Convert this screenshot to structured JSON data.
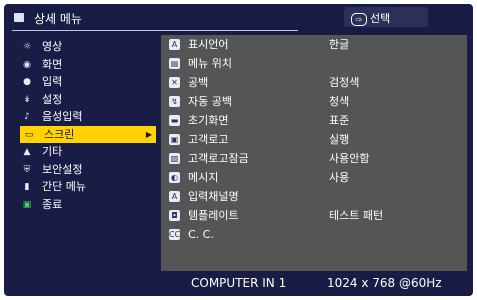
{
  "header": {
    "title": "상세 메뉴",
    "select_label": "선택",
    "select_key": "⇨"
  },
  "left_menu": {
    "items": [
      {
        "label": "영상",
        "icon": "brightness-icon"
      },
      {
        "label": "화면",
        "icon": "screen-icon"
      },
      {
        "label": "입력",
        "icon": "input-icon"
      },
      {
        "label": "설정",
        "icon": "setup-icon"
      },
      {
        "label": "음성입력",
        "icon": "audio-icon"
      },
      {
        "label": "스크린",
        "icon": "screen-menu-icon"
      },
      {
        "label": "기타",
        "icon": "option-icon"
      },
      {
        "label": "보안설정",
        "icon": "security-icon"
      },
      {
        "label": "간단 메뉴",
        "icon": "easy-menu-icon"
      },
      {
        "label": "종료",
        "icon": "exit-icon"
      }
    ]
  },
  "right_menu": {
    "items": [
      {
        "label": "표시언어",
        "value": "한글",
        "icon": "language-icon"
      },
      {
        "label": "메뉴 위치",
        "value": "",
        "icon": "menu-position-icon"
      },
      {
        "label": "공백",
        "value": "검정색",
        "icon": "blank-icon"
      },
      {
        "label": "자동 공백",
        "value": "청색",
        "icon": "auto-blank-icon"
      },
      {
        "label": "초기화면",
        "value": "표준",
        "icon": "start-up-icon"
      },
      {
        "label": "고객로고",
        "value": "실행",
        "icon": "my-screen-icon"
      },
      {
        "label": "고객로고잠금",
        "value": "사용안함",
        "icon": "my-screen-lock-icon"
      },
      {
        "label": "메시지",
        "value": "사용",
        "icon": "message-icon"
      },
      {
        "label": "입력채널명",
        "value": "",
        "icon": "source-name-icon"
      },
      {
        "label": "템플레이트",
        "value": "테스트 패턴",
        "icon": "template-icon"
      },
      {
        "label": "C. C.",
        "value": "",
        "icon": "closed-caption-icon"
      }
    ]
  },
  "status": {
    "source": "COMPUTER IN 1",
    "resolution": "1024 x 768 @60Hz"
  },
  "colors": {
    "background": "#191d45",
    "panel": "#545656",
    "highlight": "#ffd200"
  }
}
